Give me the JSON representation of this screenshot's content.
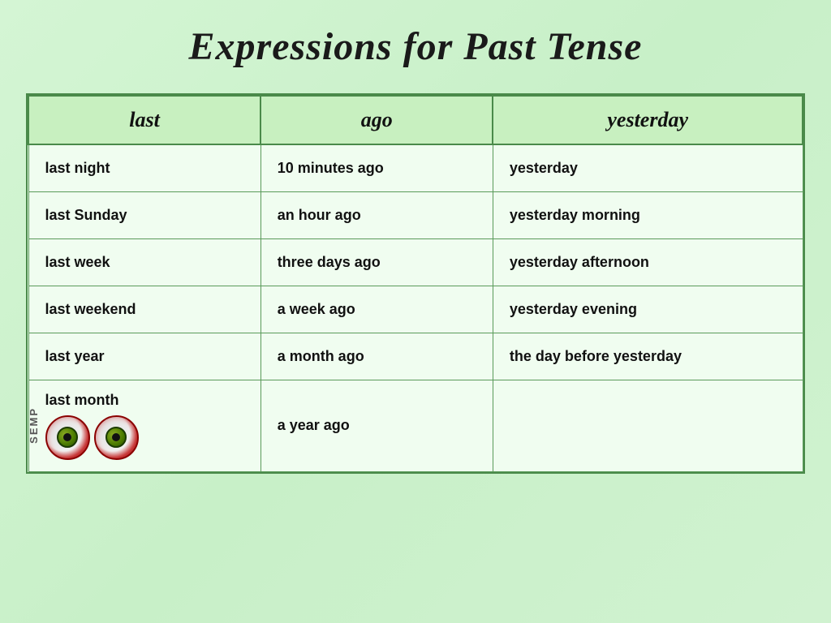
{
  "title": "Expressions for Past Tense",
  "table": {
    "headers": [
      "last",
      "ago",
      "yesterday"
    ],
    "rows": [
      [
        "last night",
        "10 minutes ago",
        "yesterday"
      ],
      [
        "last Sunday",
        "an hour ago",
        "yesterday morning"
      ],
      [
        "last week",
        "three days ago",
        "yesterday afternoon"
      ],
      [
        "last weekend",
        "a week ago",
        "yesterday evening"
      ],
      [
        "last year",
        "a month ago",
        "the day before yesterday"
      ],
      [
        "last month",
        "a year ago",
        ""
      ]
    ]
  },
  "watermark": "SEMP"
}
